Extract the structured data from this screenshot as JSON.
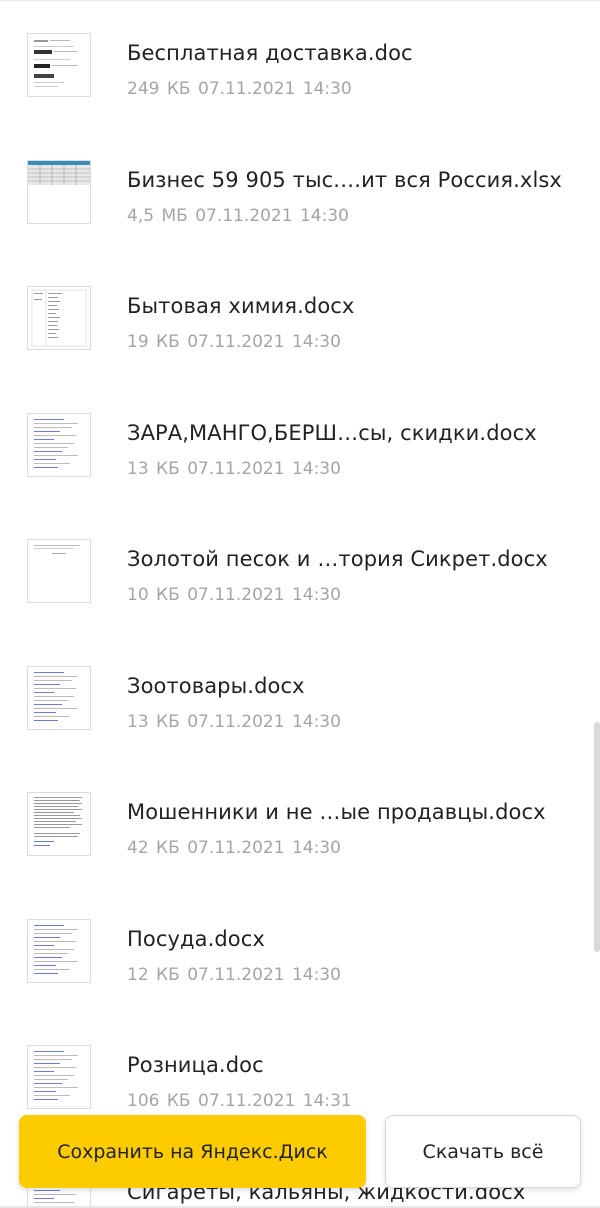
{
  "files": [
    {
      "name": "Бесплатная доставка.doc",
      "size": "249 КБ",
      "date": "07.11.2021",
      "time": "14:30",
      "thumb": "doc-dark-blocks"
    },
    {
      "name": "Бизнес 59 905 тыс.…ит вся Россия.xlsx",
      "size": "4,5 МБ",
      "date": "07.11.2021",
      "time": "14:30",
      "thumb": "xlsx"
    },
    {
      "name": "Бытовая химия.docx",
      "size": "19 КБ",
      "date": "07.11.2021",
      "time": "14:30",
      "thumb": "doc-table"
    },
    {
      "name": "ЗАРА,МАНГО,БЕРШ…сы, скидки.docx",
      "size": "13 КБ",
      "date": "07.11.2021",
      "time": "14:30",
      "thumb": "doc-links"
    },
    {
      "name": "Золотой песок и …тория Сикрет.docx",
      "size": "10 КБ",
      "date": "07.11.2021",
      "time": "14:30",
      "thumb": "doc-sparse"
    },
    {
      "name": "Зоотовары.docx",
      "size": "13 КБ",
      "date": "07.11.2021",
      "time": "14:30",
      "thumb": "doc-links"
    },
    {
      "name": "Мошенники и не …ые продавцы.docx",
      "size": "42 КБ",
      "date": "07.11.2021",
      "time": "14:30",
      "thumb": "doc-dense"
    },
    {
      "name": "Посуда.docx",
      "size": "12 КБ",
      "date": "07.11.2021",
      "time": "14:30",
      "thumb": "doc-links"
    },
    {
      "name": "Розница.doc",
      "size": "106 КБ",
      "date": "07.11.2021",
      "time": "14:31",
      "thumb": "doc-links"
    },
    {
      "name": "Сигареты, кальяны, жидкости.docx",
      "size": "",
      "date": "",
      "time": "",
      "thumb": "doc-links"
    }
  ],
  "actions": {
    "save_label": "Сохранить на Яндекс.Диск",
    "download_label": "Скачать всё"
  },
  "colors": {
    "accent": "#fccc00",
    "text": "#222222",
    "meta": "#a5a5a5"
  }
}
